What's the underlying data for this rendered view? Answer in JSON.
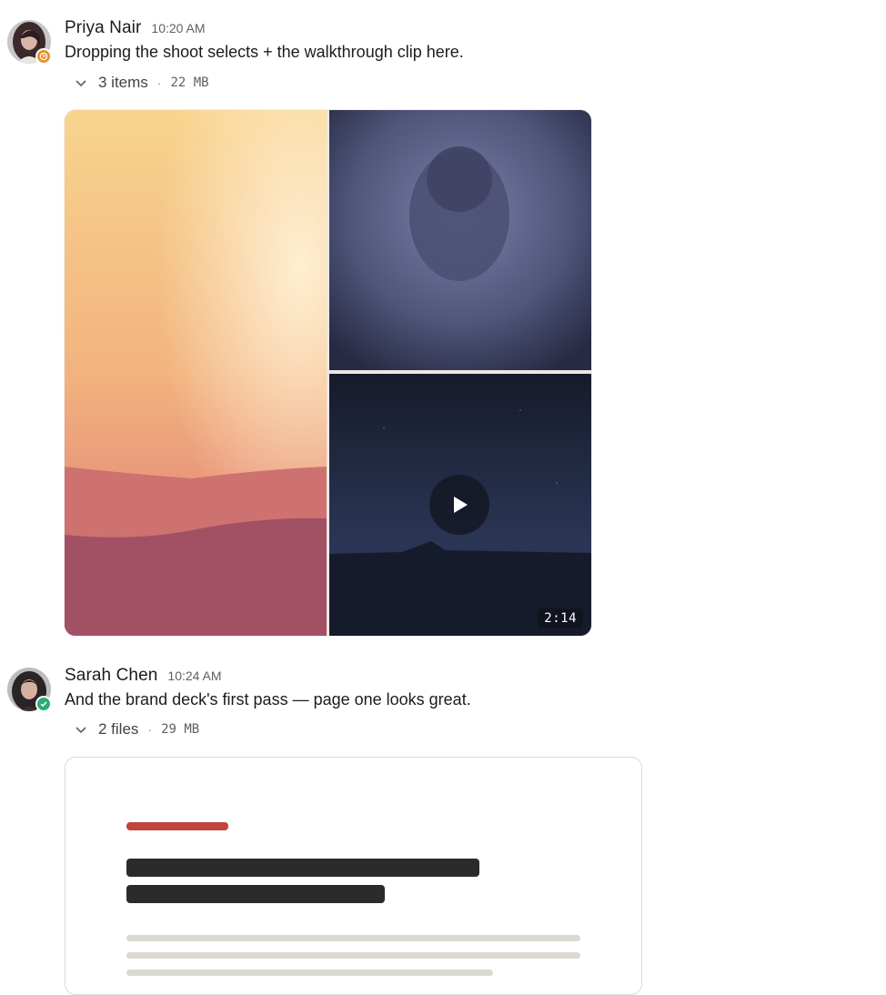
{
  "messages": [
    {
      "author": "Priya Nair",
      "time": "10:20 AM",
      "text": "Dropping the shoot selects + the walkthrough clip here.",
      "status": "away-clock",
      "status_color": "#e8912d",
      "attachments": {
        "count_label": "3 items",
        "separator": "·",
        "size": "22 MB",
        "video_duration": "2:14"
      }
    },
    {
      "author": "Sarah Chen",
      "time": "10:24 AM",
      "text": "And the brand deck's first pass — page one looks great.",
      "status": "active-check",
      "status_color": "#2bac76",
      "attachments": {
        "count_label": "2 files",
        "separator": "·",
        "size": "29 MB"
      }
    }
  ],
  "icons": {
    "expand": "chevron-down-icon",
    "play": "play-icon",
    "status_away": "clock-icon",
    "status_active": "check-icon"
  },
  "colors": {
    "doc_accent": "#c0453b",
    "doc_heading": "#2b2b2b",
    "doc_body": "#dcd8d2"
  }
}
